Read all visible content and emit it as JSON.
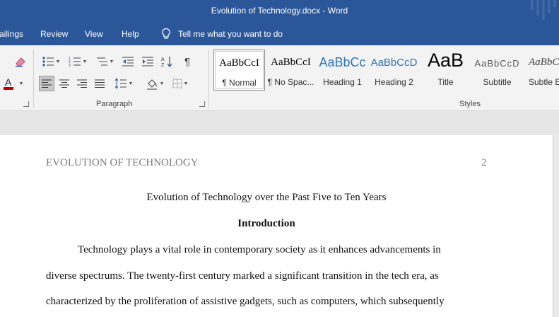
{
  "window": {
    "title": "Evolution of Technology.docx  -  Word"
  },
  "tabs": [
    {
      "label": "ailings"
    },
    {
      "label": "Review"
    },
    {
      "label": "View"
    },
    {
      "label": "Help"
    }
  ],
  "tell_me": {
    "label": "Tell me what you want to do"
  },
  "ribbon": {
    "paragraph_group_label": "Paragraph",
    "styles_group_label": "Styles",
    "styles": [
      {
        "sample": "AaBbCcI",
        "name": "¶ Normal",
        "color": "#000000",
        "selected": true
      },
      {
        "sample": "AaBbCcI",
        "name": "¶ No Spac...",
        "color": "#000000",
        "selected": false
      },
      {
        "sample": "AaBbCc",
        "name": "Heading 1",
        "color": "#2e74b5",
        "selected": false
      },
      {
        "sample": "AaBbCcD",
        "name": "Heading 2",
        "color": "#2e74b5",
        "selected": false
      },
      {
        "sample": "AaB",
        "name": "Title",
        "color": "#000000",
        "selected": false
      },
      {
        "sample": "AaBbCcD",
        "name": "Subtitle",
        "color": "#595959",
        "selected": false
      },
      {
        "sample": "AaBbCcl",
        "name": "Subtle Em",
        "color": "#404040",
        "selected": false
      }
    ],
    "font_color": "#c00000"
  },
  "document": {
    "running_head": "EVOLUTION OF TECHNOLOGY",
    "page_number": "2",
    "title": "Evolution of Technology over the Past Five to Ten Years",
    "heading": "Introduction",
    "lines": [
      "Technology plays a vital role in contemporary society as it enhances advancements in",
      "diverse spectrums. The twenty-first century marked a significant transition in the tech era, as",
      "characterized by the proliferation of assistive gadgets, such as computers, which subsequently"
    ]
  }
}
